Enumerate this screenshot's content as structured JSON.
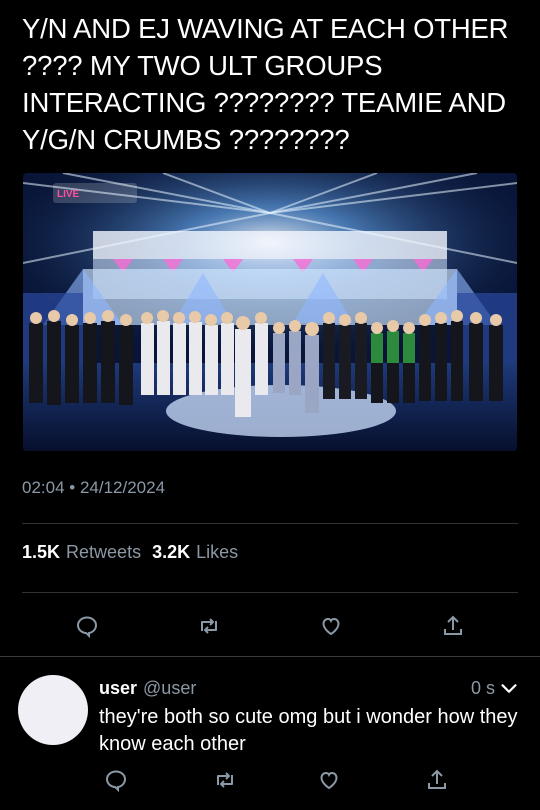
{
  "tweet": {
    "text": "Y/N AND EJ WAVING AT EACH OTHER ???? MY TWO ULT GROUPS INTERACTING ???????? TEAMIE AND Y/G/N CRUMBS ????????",
    "media_logo": "LIVE",
    "timestamp": "02:04 • 24/12/2024",
    "retweets_count": "1.5K",
    "retweets_label": "Retweets",
    "likes_count": "3.2K",
    "likes_label": "Likes"
  },
  "actions": [
    "reply-icon",
    "retweet-icon",
    "like-icon",
    "share-icon"
  ],
  "reply": {
    "name": "user",
    "handle": "@user",
    "time": "0 s",
    "text": "they're both so cute omg but i wonder how they know each other"
  },
  "colors": {
    "background": "#000000",
    "secondary_text": "#8b98a5",
    "divider": "#2f3336",
    "avatar": "#f0eff5"
  }
}
